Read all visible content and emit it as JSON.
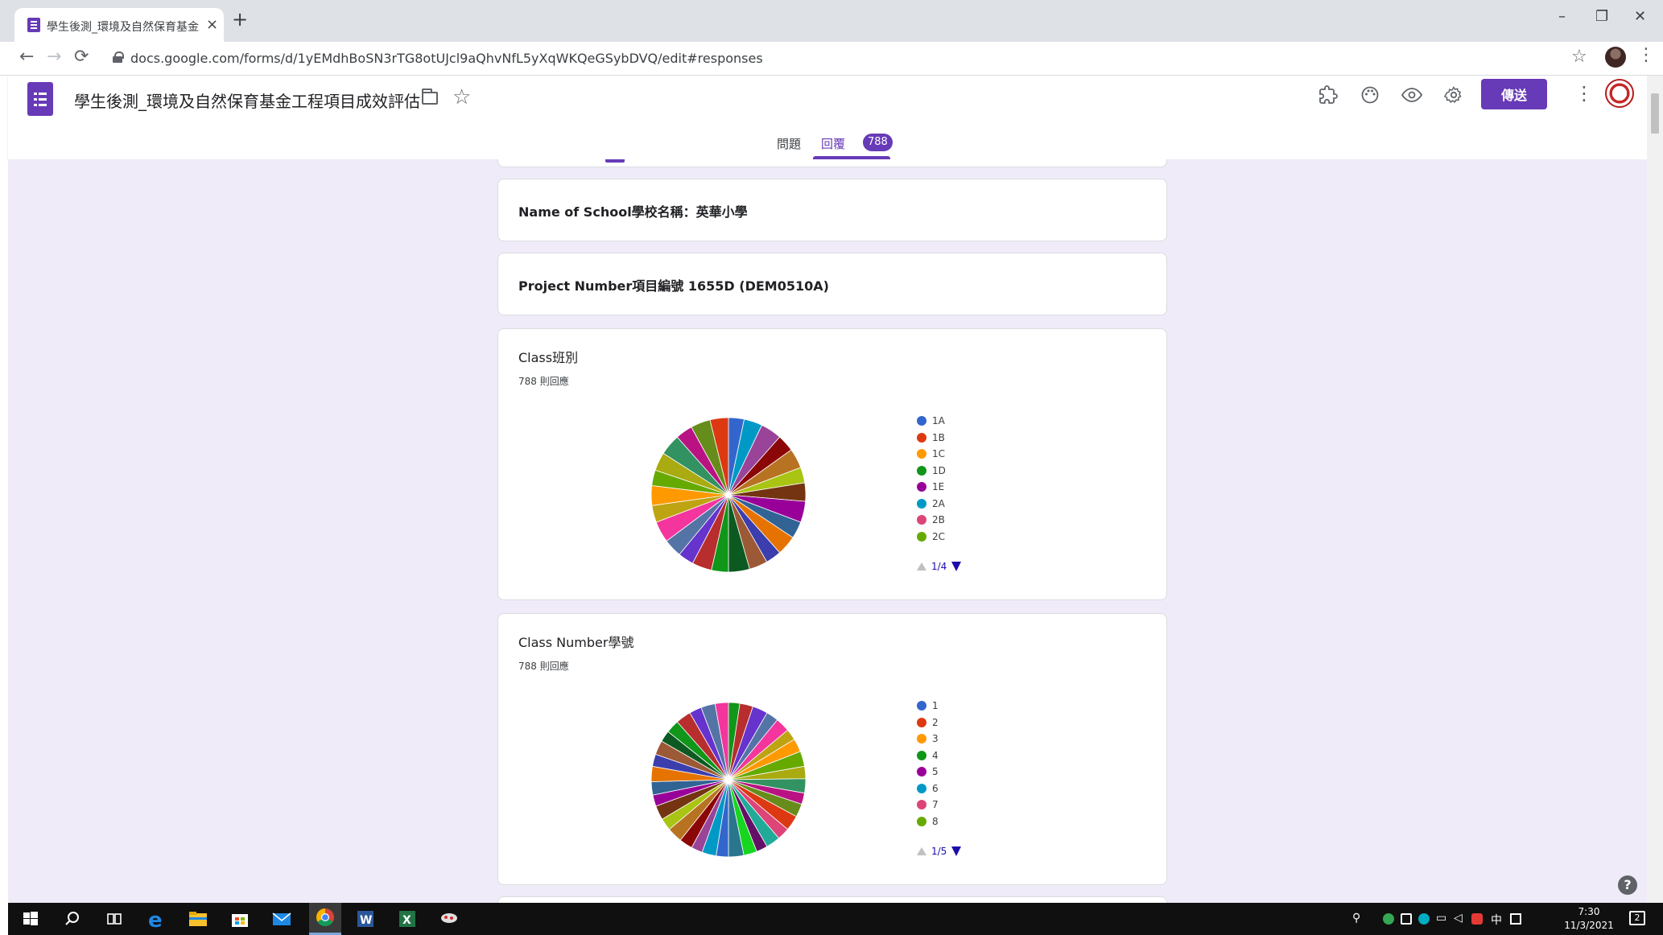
{
  "browser": {
    "tab_title": "學生後測_環境及自然保育基金工",
    "tab_close": "×",
    "new_tab": "+",
    "url": "docs.google.com/forms/d/1yEMdhBoSN3rTG8otUJcl9aQhvNfL5yXqWKQeGSybDVQ/edit#responses",
    "window_controls": {
      "minimize": "–",
      "restore": "❐",
      "close": "✕"
    },
    "nav": {
      "back": "←",
      "forward": "→",
      "reload": "⟳"
    },
    "bookmark_star": "☆",
    "menu": "⋮"
  },
  "form_header": {
    "title": "學生後測_環境及自然保育基金工程項目成效評估",
    "star": "☆",
    "send_label": "傳送",
    "more": "⋮",
    "tabs": {
      "questions": "問題",
      "responses": "回覆",
      "responses_count": "788"
    },
    "icons": [
      "addon-icon",
      "palette-icon",
      "preview-eye-icon",
      "settings-gear-icon"
    ]
  },
  "cards": {
    "school": {
      "text": "Name of School學校名稱：英華小學"
    },
    "project": {
      "text": "Project Number項目編號 1655D (DEM0510A)"
    },
    "class": {
      "title": "Class班別",
      "count": "788 則回應",
      "legend": [
        "1A",
        "1B",
        "1C",
        "1D",
        "1E",
        "2A",
        "2B",
        "2C"
      ],
      "pager": "1/4"
    },
    "class_number": {
      "title": "Class Number學號",
      "count": "788 則回應",
      "legend": [
        "1",
        "2",
        "3",
        "4",
        "5",
        "6",
        "7",
        "8"
      ],
      "pager": "1/5"
    }
  },
  "palette": [
    "#3366cc",
    "#dc3912",
    "#ff9900",
    "#109618",
    "#990099",
    "#0099c6",
    "#dd4477",
    "#66aa00",
    "#b82e2e",
    "#316395",
    "#994499",
    "#22aa99",
    "#aaaa11",
    "#6633cc",
    "#e67300",
    "#8b0707",
    "#651067",
    "#329262",
    "#5574a6",
    "#3b3eac",
    "#b77322",
    "#16d620",
    "#b91383",
    "#f4359e",
    "#9c5935",
    "#a9c413",
    "#2a778d",
    "#668d1c",
    "#bea413",
    "#0c5922",
    "#743411"
  ],
  "chart_data": [
    {
      "type": "pie",
      "title": "Class班別",
      "categories": [
        "1A",
        "1B",
        "1C",
        "1D",
        "1E",
        "2A",
        "2B",
        "2C"
      ],
      "slices": 26
    },
    {
      "type": "pie",
      "title": "Class Number學號",
      "categories": [
        "1",
        "2",
        "3",
        "4",
        "5",
        "6",
        "7",
        "8"
      ],
      "slices": 36
    }
  ],
  "help": "?",
  "clock": {
    "time": "7:30",
    "date": "11/3/2021"
  },
  "tray": {
    "ime": "中",
    "notifications": "2"
  }
}
